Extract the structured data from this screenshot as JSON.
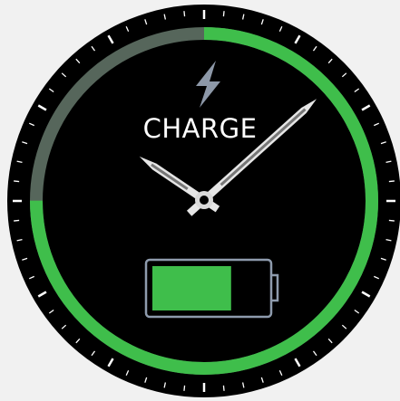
{
  "watch_face": {
    "mode_label": "CHARGE",
    "charge_level": 0.75,
    "battery_level": 0.7,
    "colors": {
      "accent": "#3fbe4b",
      "ring_track": "#56665b",
      "face": "#000000",
      "bolt": "#8d98a8",
      "battery_outline": "#8e9bad",
      "hands": "#e6e6e6"
    },
    "time": {
      "hour": 10,
      "minute": 8
    }
  }
}
